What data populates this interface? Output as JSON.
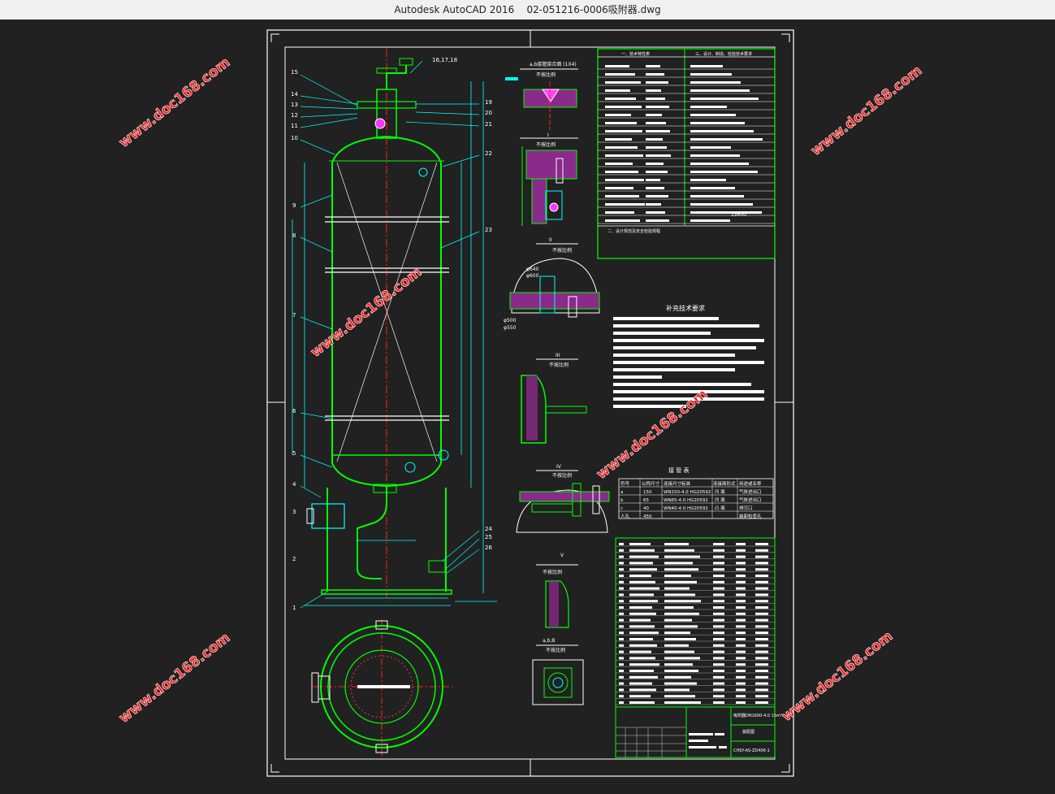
{
  "window": {
    "app_name": "Autodesk AutoCAD 2016",
    "file_name": "02-051216-0006吸附器.dwg"
  },
  "watermark": "www.doc168.com",
  "drawing": {
    "callouts_left": [
      "15",
      "14",
      "13",
      "12",
      "11",
      "10",
      "9",
      "8",
      "7",
      "6",
      "5",
      "4",
      "3",
      "2",
      "1"
    ],
    "callouts_top": "16,17,18",
    "callouts_right": [
      "19",
      "20",
      "21",
      "22",
      "23",
      "24",
      "25",
      "26"
    ],
    "view_titles": {
      "a": "a,b接管接合面 (1X4)",
      "scale": "不按比例",
      "I": "I",
      "II": "II",
      "III": "III",
      "IV": "IV",
      "V": "V",
      "abB": "a,b,B"
    },
    "tech_table": {
      "header_left": "一、技术特性表",
      "header_right": "三、设计、制造、检验技术要求",
      "section_2": "二、设计规范及安全检验规程",
      "value": "15600"
    },
    "supplement_title": "补充技术要求",
    "nozzle_table": {
      "title": "接 管 表",
      "headers": [
        "符号",
        "公称尺寸",
        "连接尺寸标准",
        "连接面形式",
        "用途或名称"
      ],
      "rows": [
        [
          "a",
          "150",
          "WN150-4.0 HG20592",
          "凹 面",
          "气体进出口"
        ],
        [
          "b",
          "65",
          "WN65-4.0 HG20592",
          "凹 面",
          "气体进出口"
        ],
        [
          "c",
          "40",
          "WN40-4.0 HG20592",
          "凸 面",
          "排污口"
        ],
        [
          "人孔",
          "450",
          "",
          "",
          "装卸检查孔"
        ]
      ]
    },
    "title_block": {
      "name_line1": "吸附器DN1600-4.0 15m³",
      "name_line2": "装配图",
      "drawing_no": "CHSY-AS-ZD406-1"
    },
    "dims": {
      "d640": "φ640",
      "d600": "φ600",
      "d500": "φ500",
      "d550": "φ550"
    }
  }
}
